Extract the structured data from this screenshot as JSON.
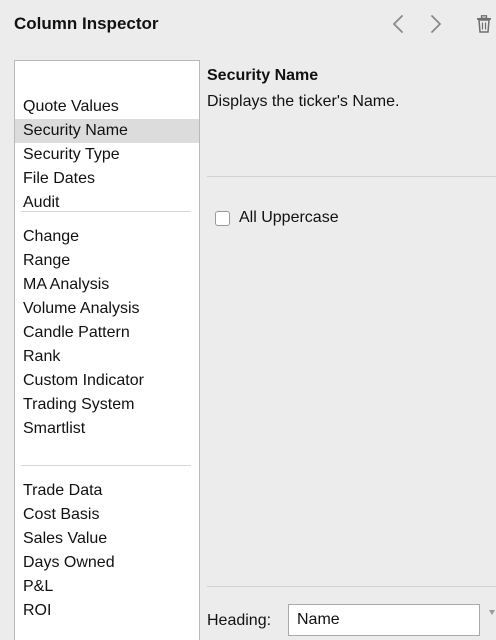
{
  "header": {
    "title": "Column Inspector",
    "back_icon": "chevron-left-icon",
    "forward_icon": "chevron-right-icon",
    "delete_icon": "trash-icon"
  },
  "sidebar": {
    "groups": [
      [
        "Quote Values",
        "Security Name",
        "Security Type",
        "File Dates",
        "Audit"
      ],
      [
        "Change",
        "Range",
        "MA Analysis",
        "Volume Analysis",
        "Candle Pattern",
        "Rank",
        "Custom Indicator",
        "Trading System",
        "Smartlist"
      ],
      [
        "Trade Data",
        "Cost Basis",
        "Sales Value",
        "Days Owned",
        "P&L",
        "ROI"
      ]
    ],
    "selected": "Security Name"
  },
  "detail": {
    "title": "Security Name",
    "description": "Displays the ticker's Name.",
    "uppercase_label": "All Uppercase",
    "uppercase_checked": false
  },
  "footer": {
    "heading_label": "Heading:",
    "heading_value": "Name"
  },
  "colors": {
    "background": "#ececec",
    "selection": "#dcdcdc",
    "panel": "#ffffff"
  }
}
